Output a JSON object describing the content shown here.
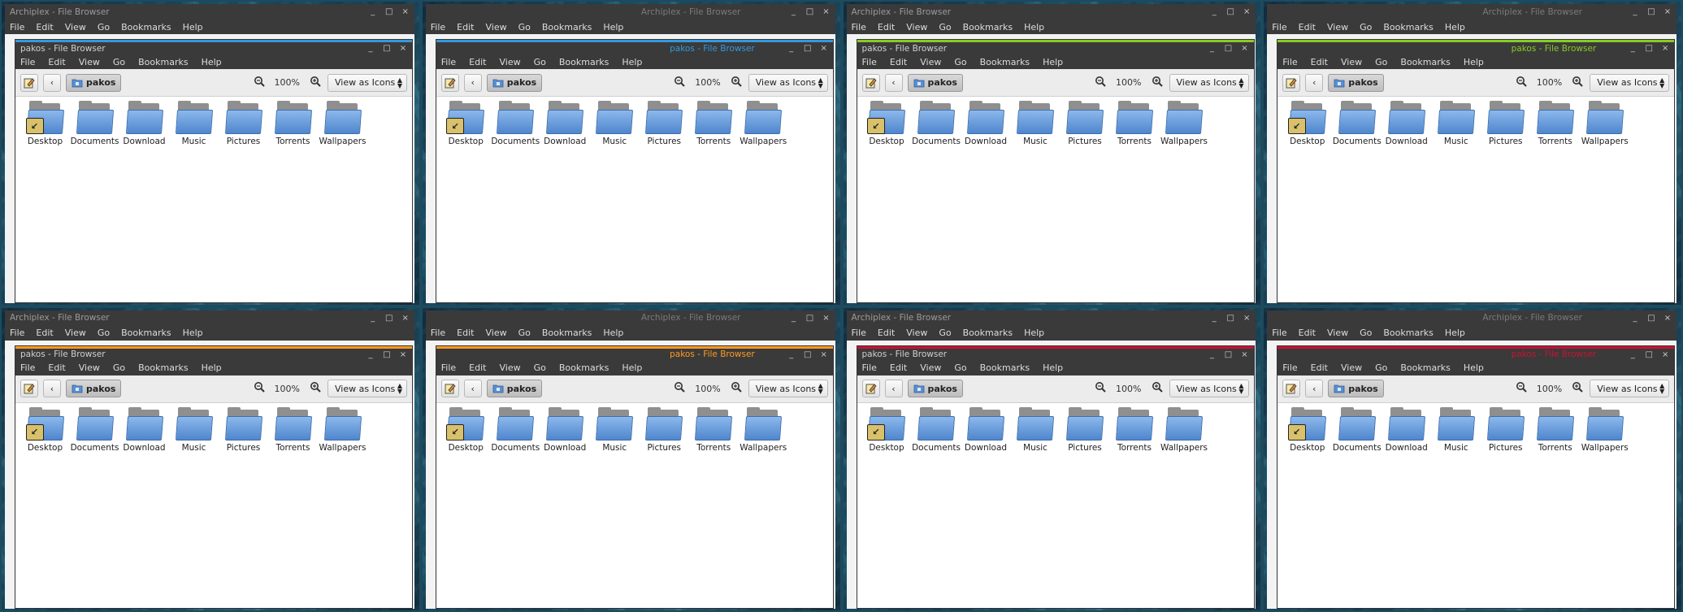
{
  "back_window": {
    "title": "Archiplex - File Browser",
    "menu": [
      "File",
      "Edit",
      "View",
      "Go",
      "Bookmarks",
      "Help"
    ]
  },
  "front_window": {
    "title": "pakos - File Browser",
    "menu": [
      "File",
      "Edit",
      "View",
      "Go",
      "Bookmarks",
      "Help"
    ],
    "controls": [
      "_",
      "□",
      "×"
    ]
  },
  "toolbar": {
    "location": "pakos",
    "zoom": "100%",
    "view_mode": "View as Icons"
  },
  "files": [
    "Desktop",
    "Documents",
    "Download",
    "Music",
    "Pictures",
    "Torrents",
    "Wallpapers"
  ],
  "panels": [
    {
      "accent": "#3399dd",
      "title_align": "left"
    },
    {
      "accent": "#3399dd",
      "title_align": "right"
    },
    {
      "accent": "#88cc22",
      "title_align": "left"
    },
    {
      "accent": "#88cc22",
      "title_align": "right"
    },
    {
      "accent": "#ff9922",
      "title_align": "left"
    },
    {
      "accent": "#ff9922",
      "title_align": "right"
    },
    {
      "accent": "#cc1133",
      "title_align": "left"
    },
    {
      "accent": "#cc1133",
      "title_align": "right"
    }
  ]
}
